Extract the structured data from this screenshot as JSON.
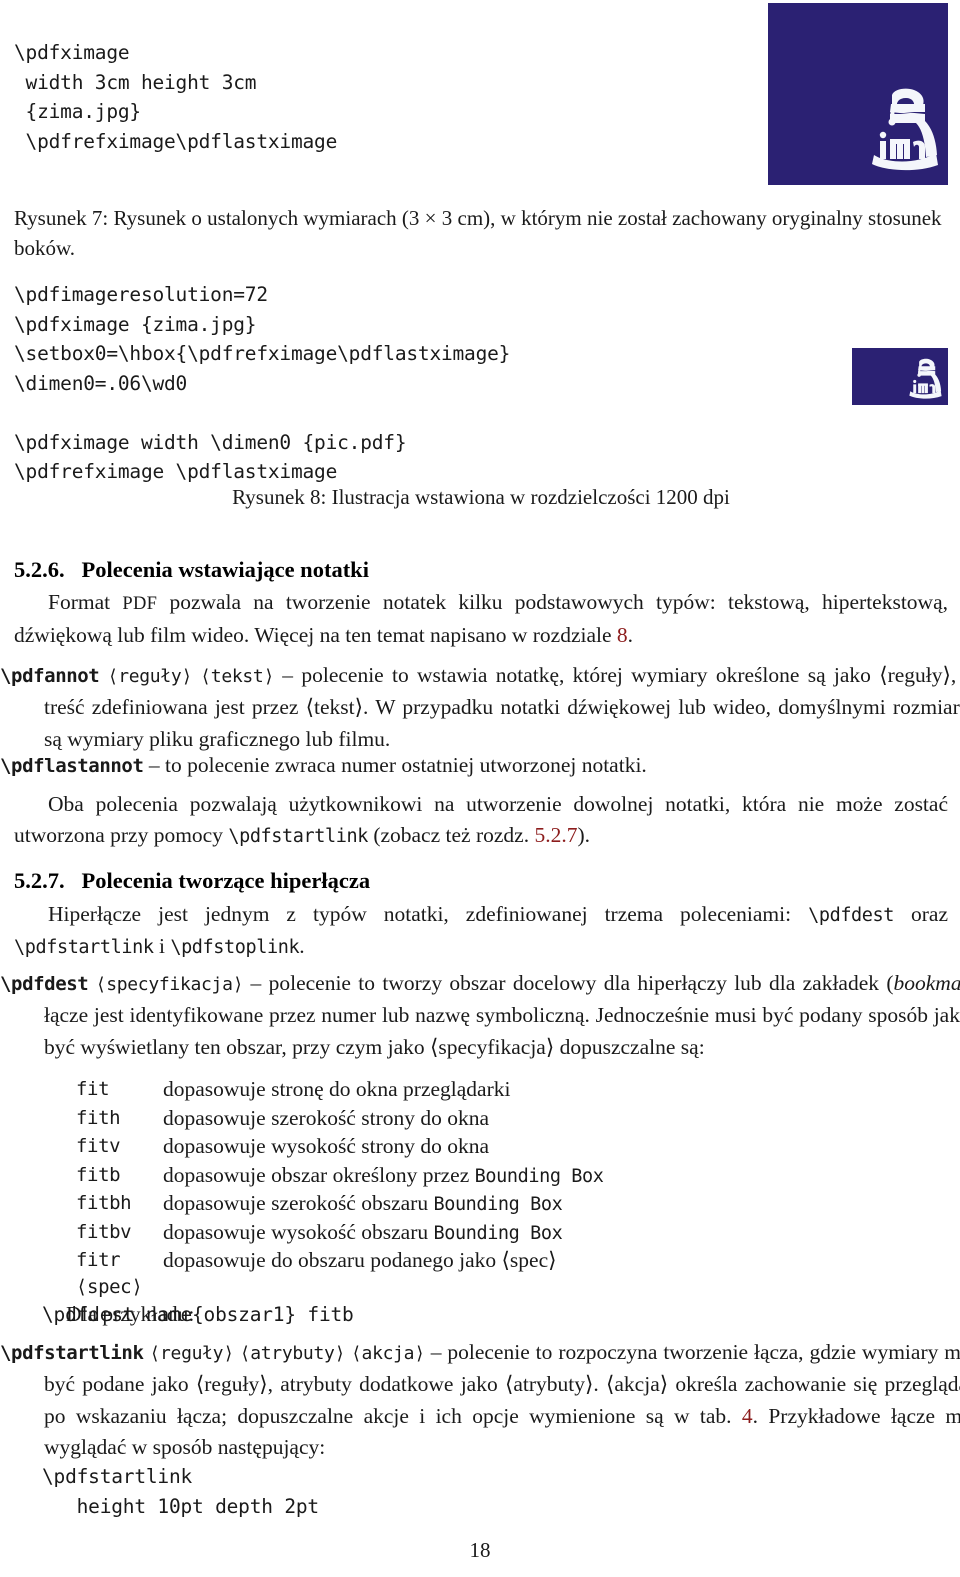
{
  "document": {
    "page_number": "18",
    "link_color": "#8c1c1c",
    "image_bg_color": "#2b2173",
    "logo_name": "zima-swan-logo"
  },
  "figure7": {
    "code": "\\pdfximage\n width 3cm height 3cm\n {zima.jpg}\n \\pdfrefximage\\pdflastximage",
    "caption": "Rysunek 7: Rysunek o ustalonych wymiarach (3 × 3 cm), w którym nie został zachowany oryginalny stosunek boków."
  },
  "figure8": {
    "code": "\\pdfimageresolution=72\n\\pdfximage {zima.jpg}\n\\setbox0=\\hbox{\\pdfrefximage\\pdflastximage}\n\\dimen0=.06\\wd0\n\n\\pdfximage width \\dimen0 {pic.pdf}\n\\pdfrefximage \\pdflastximage",
    "caption": "Rysunek 8: Ilustracja wstawiona w rozdzielczości 1200 dpi"
  },
  "section_526": {
    "number": "5.2.6.",
    "title": "Polecenia wstawiające notatki",
    "paragraph_pre": "Format ",
    "paragraph_sc": "PDF",
    "paragraph_post": " pozwala na tworzenie notatek kilku podstawowych typów: tekstową, hipertekstową, dźwiękową lub film wideo. Więcej na ten temat napisano w rozdziale ",
    "paragraph_ref": "8",
    "paragraph_end": "."
  },
  "entry_pdfannot": {
    "command": "\\pdfannot",
    "arg1": "⟨reguły⟩",
    "arg2": "⟨tekst⟩",
    "dash": " – ",
    "text": "polecenie to wstawia notatkę, której wymiary określone są jako ⟨reguły⟩, zaś treść zdefiniowana jest przez ⟨tekst⟩. W przypadku notatki dźwiękowej lub wideo, domyślnymi rozmiarami są wymiary pliku graficznego lub filmu."
  },
  "entry_pdflastannot": {
    "command": "\\pdflastannot",
    "dash": " – ",
    "text": "to polecenie zwraca numer ostatniej utworzonej notatki."
  },
  "para_oba": {
    "part1": "Oba polecenia pozwalają użytkownikowi na utworzenie dowolnej notatki, która nie może zostać utworzona przy pomocy ",
    "cmd": "\\pdfstartlink",
    "part2": " (zobacz też rozdz. ",
    "ref": "5.2.7",
    "part3": ")."
  },
  "section_527": {
    "number": "5.2.7.",
    "title": "Polecenia tworzące hiperłącza",
    "para_part1": "Hiperłącze jest jednym z typów notatki, zdefiniowanej trzema poleceniami: ",
    "para_cmd1": "\\pdfdest",
    "para_part2": " oraz ",
    "para_cmd2": "\\pdfstartlink",
    "para_part3": " i ",
    "para_cmd3": "\\pdfstoplink",
    "para_part4": "."
  },
  "entry_pdfdest": {
    "command": "\\pdfdest",
    "arg1": "⟨specyfikacja⟩",
    "dash": " – ",
    "text_a": "polecenie to tworzy obszar docelowy dla hiperłączy lub dla zakładek (",
    "text_italic": "bookmark",
    "text_b": "), łącze jest identyfikowane przez numer lub nazwę symboliczną. Jednocześnie musi być podany sposób jak ma być wyświetlany ten obszar, przy czym jako ⟨specyfikacja⟩ dopuszczalne są:"
  },
  "spec_list": {
    "rows": [
      {
        "key": "fit",
        "value_pre": "dopasowuje stronę do okna przeglądarki",
        "value_mono": "",
        "value_post": ""
      },
      {
        "key": "fith",
        "value_pre": "dopasowuje szerokość strony do okna",
        "value_mono": "",
        "value_post": ""
      },
      {
        "key": "fitv",
        "value_pre": "dopasowuje wysokość strony do okna",
        "value_mono": "",
        "value_post": ""
      },
      {
        "key": "fitb",
        "value_pre": "dopasowuje obszar określony przez ",
        "value_mono": "Bounding Box",
        "value_post": ""
      },
      {
        "key": "fitbh",
        "value_pre": "dopasowuje szerokość obszaru ",
        "value_mono": "Bounding Box",
        "value_post": ""
      },
      {
        "key": "fitbv",
        "value_pre": "dopasowuje wysokość obszaru ",
        "value_mono": "Bounding Box",
        "value_post": ""
      },
      {
        "key": "fitr ⟨spec⟩",
        "value_pre": "dopasowuje do obszaru podanego jako ⟨spec⟩",
        "value_mono": "",
        "value_post": ""
      }
    ],
    "example_label": "Dla przykładu:"
  },
  "code_example_pdfdest": "\\pdfdest name{obszar1} fitb",
  "entry_pdfstartlink": {
    "command": "\\pdfstartlink",
    "arg1": "⟨reguły⟩",
    "arg2": "⟨atrybuty⟩",
    "arg3": "⟨akcja⟩",
    "dash": " – ",
    "text_a": "polecenie to rozpoczyna tworzenie łącza, gdzie wymiary mogą być podane jako ⟨reguły⟩, atrybuty dodatkowe jako ⟨atrybuty⟩. ⟨akcja⟩ określa zachowanie się przeglądarki po wskazaniu łącza; dopuszczalne akcje i ich opcje wymienione są w tab. ",
    "ref": "4",
    "text_b": ".  Przykładowe łącze może wyglądać w sposób następujący:"
  },
  "code_example_pdfstartlink": "\\pdfstartlink\n   height 10pt depth 2pt"
}
